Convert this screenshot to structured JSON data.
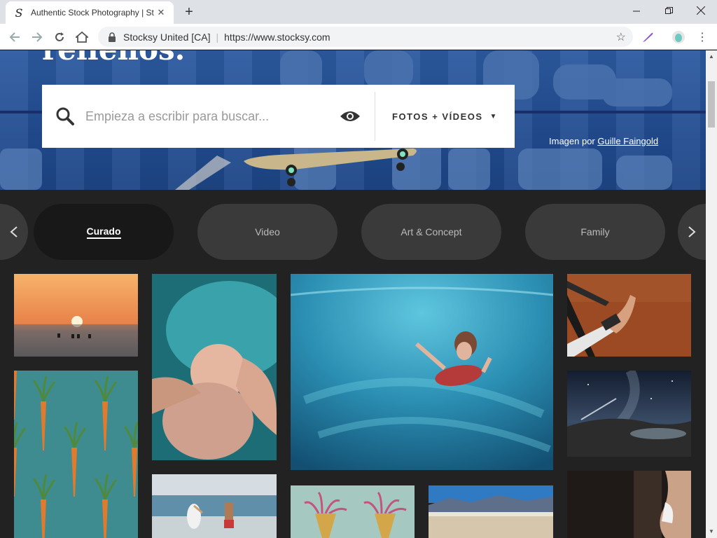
{
  "browser": {
    "tab_title": "Authentic Stock Photography | St",
    "tab_favicon": "S",
    "new_tab": "+",
    "site_identity": "Stocksy United [CA]",
    "url": "https://www.stocksy.com"
  },
  "hero": {
    "heading": "rellenos.",
    "search": {
      "placeholder": "Empieza a escribir para buscar...",
      "type_label": "FOTOS + VÍDEOS"
    },
    "credit_prefix": "Imagen por",
    "credit_name": "Guille Faingold"
  },
  "categories": {
    "items": [
      "Curado",
      "Video",
      "Art & Concept",
      "Family"
    ],
    "active": "Curado"
  },
  "photos": [
    {
      "name": "sunset-ocean-photo",
      "colors": [
        "#f29a55",
        "#d96a3c",
        "#3a3e45"
      ]
    },
    {
      "name": "newborn-bath-photo",
      "colors": [
        "#2e8f9a",
        "#c99a88",
        "#1a5660"
      ]
    },
    {
      "name": "underwater-swimmer-photo",
      "colors": [
        "#3aa3c2",
        "#1c6a8c",
        "#52c3d6"
      ]
    },
    {
      "name": "foot-on-sand-photo",
      "colors": [
        "#a8552b",
        "#7a3a1e",
        "#1d1d1d"
      ]
    },
    {
      "name": "carrot-pattern-photo",
      "colors": [
        "#3f8f93",
        "#e27a2e",
        "#4a8a3c"
      ]
    },
    {
      "name": "night-sky-landscape-photo",
      "colors": [
        "#1e2a3c",
        "#35465e",
        "#6a7a8a"
      ]
    },
    {
      "name": "boy-pelican-beach-photo",
      "colors": [
        "#7fa9c2",
        "#c9d6dc",
        "#aa9a86"
      ]
    },
    {
      "name": "sea-anemone-illustration",
      "colors": [
        "#a8c9c2",
        "#c55a78",
        "#d3a64a"
      ]
    },
    {
      "name": "desert-mountains-photo",
      "colors": [
        "#3a7fc2",
        "#6a8a9c",
        "#c8b59a"
      ]
    },
    {
      "name": "woman-doorway-photo",
      "colors": [
        "#2a2320",
        "#4a3a30",
        "#c9a488"
      ]
    }
  ]
}
